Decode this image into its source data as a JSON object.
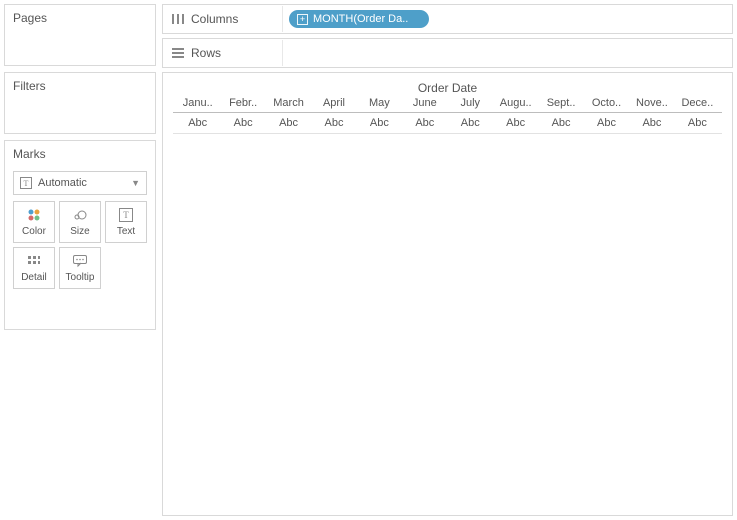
{
  "panels": {
    "pages": "Pages",
    "filters": "Filters",
    "marks": "Marks"
  },
  "marks": {
    "type": "Automatic",
    "cards": {
      "color": "Color",
      "size": "Size",
      "text": "Text",
      "detail": "Detail",
      "tooltip": "Tooltip"
    }
  },
  "shelves": {
    "columns": "Columns",
    "rows": "Rows"
  },
  "pill": {
    "columns": "MONTH(Order Da.."
  },
  "viz": {
    "title": "Order Date",
    "months": [
      "Janu..",
      "Febr..",
      "March",
      "April",
      "May",
      "June",
      "July",
      "Augu..",
      "Sept..",
      "Octo..",
      "Nove..",
      "Dece.."
    ],
    "placeholder": "Abc"
  }
}
